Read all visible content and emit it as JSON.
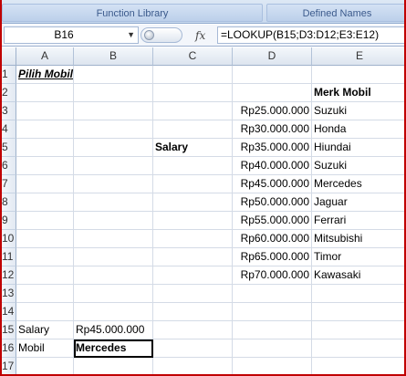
{
  "ribbon": {
    "groups": [
      "Function Library",
      "Defined Names"
    ]
  },
  "formula_bar": {
    "name_box": "B16",
    "fx_label": "fx",
    "formula": "=LOOKUP(B15;D3:D12;E3:E12)"
  },
  "columns": [
    "A",
    "B",
    "C",
    "D",
    "E"
  ],
  "rows": [
    "1",
    "2",
    "3",
    "4",
    "5",
    "6",
    "7",
    "8",
    "9",
    "10",
    "11",
    "12",
    "13",
    "14",
    "15",
    "16",
    "17"
  ],
  "cells": {
    "A1": "Pilih Mobil",
    "E2": "Merk Mobil",
    "C5": "Salary",
    "D3": "Rp25.000.000",
    "E3": "Suzuki",
    "D4": "Rp30.000.000",
    "E4": "Honda",
    "D5": "Rp35.000.000",
    "E5": "Hiundai",
    "D6": "Rp40.000.000",
    "E6": "Suzuki",
    "D7": "Rp45.000.000",
    "E7": "Mercedes",
    "D8": "Rp50.000.000",
    "E8": "Jaguar",
    "D9": "Rp55.000.000",
    "E9": "Ferrari",
    "D10": "Rp60.000.000",
    "E10": "Mitsubishi",
    "D11": "Rp65.000.000",
    "E11": "Timor",
    "D12": "Rp70.000.000",
    "E12": "Kawasaki",
    "A15": "Salary",
    "B15": "Rp45.000.000",
    "A16": "Mobil",
    "B16": "Mercedes"
  },
  "colors": {
    "frame_border": "#c00000",
    "ribbon_text": "#3b5a8c"
  }
}
